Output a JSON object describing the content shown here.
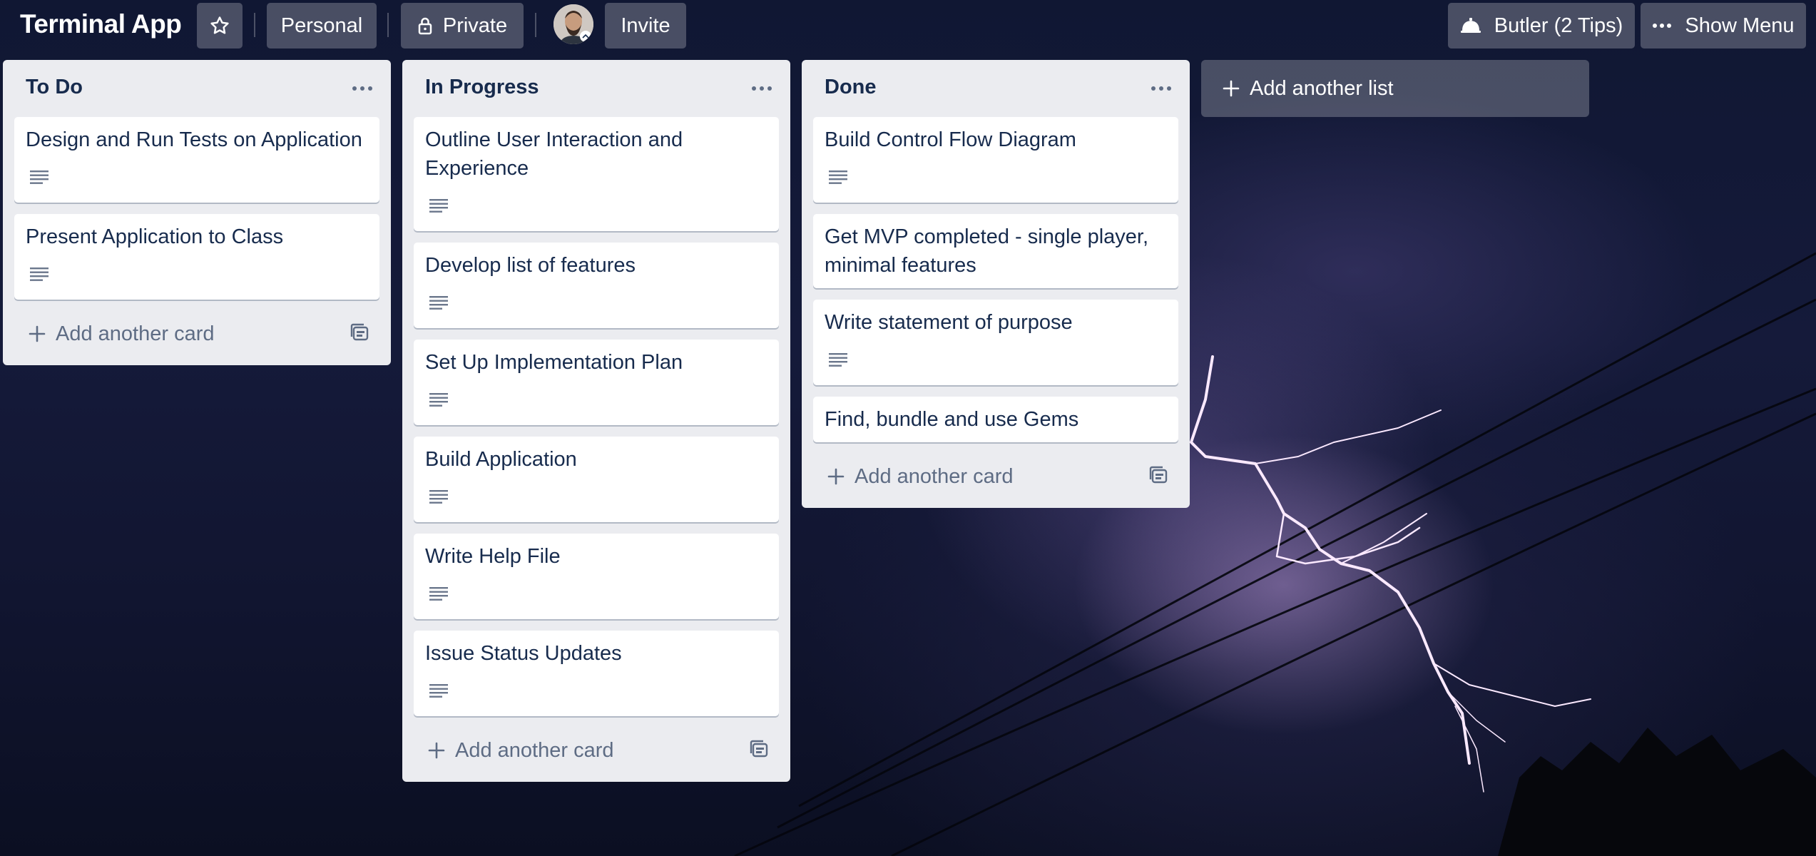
{
  "header": {
    "board_title": "Terminal App",
    "team_label": "Personal",
    "visibility_label": "Private",
    "invite_label": "Invite",
    "butler_label": "Butler (2 Tips)",
    "show_menu_label": "Show Menu"
  },
  "lists": [
    {
      "title": "To Do",
      "cards": [
        {
          "text": "Design and Run Tests on Application"
        },
        {
          "text": "Present Application to Class"
        }
      ],
      "add_card_label": "Add another card"
    },
    {
      "title": "In Progress",
      "cards": [
        {
          "text": "Outline User Interaction and Experience"
        },
        {
          "text": "Develop list of features"
        },
        {
          "text": "Set Up Implementation Plan"
        },
        {
          "text": "Build Application"
        },
        {
          "text": "Write Help File"
        },
        {
          "text": "Issue Status Updates"
        }
      ],
      "add_card_label": "Add another card"
    },
    {
      "title": "Done",
      "cards": [
        {
          "text": "Build Control Flow Diagram"
        },
        {
          "text": "Get MVP completed - single player, minimal features"
        },
        {
          "text": "Write statement of purpose"
        },
        {
          "text": "Find, bundle and use Gems"
        }
      ],
      "add_card_label": "Add another card"
    }
  ],
  "add_list_label": "Add another list",
  "colors": {
    "list_bg": "#ebecf0",
    "card_text": "#172b4d",
    "muted_text": "#5e6c84",
    "header_button": "rgba(255,255,255,0.24)"
  },
  "icons": [
    "star-icon",
    "lock-icon",
    "butler-bell-icon",
    "more-dots-icon",
    "plus-icon",
    "description-icon",
    "card-template-icon"
  ]
}
